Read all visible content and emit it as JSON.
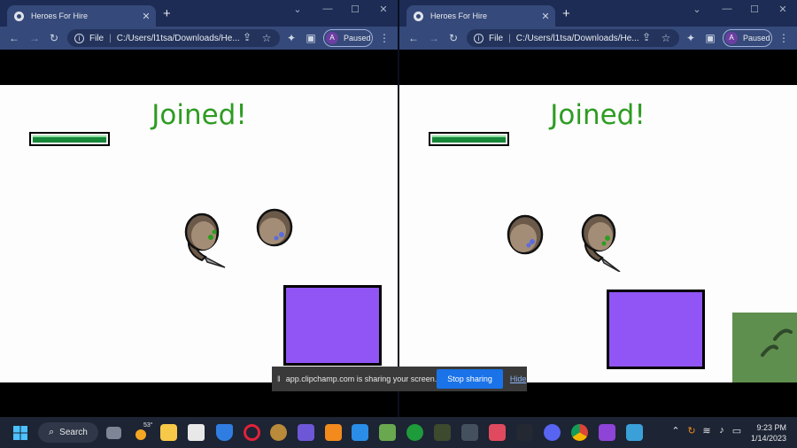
{
  "windows": {
    "left": {
      "tab_title": "Heroes For Hire",
      "address": "C:/Users/l1tsa/Downloads/He...",
      "address_scheme": "File",
      "profile_letter": "A",
      "profile_status": "Paused",
      "game_status": "Joined!"
    },
    "right": {
      "tab_title": "Heroes For Hire",
      "address": "C:/Users/l1tsa/Downloads/He...",
      "address_scheme": "File",
      "profile_letter": "A",
      "profile_status": "Paused",
      "game_status": "Joined!"
    }
  },
  "window_controls": {
    "minimize": "—",
    "maximize": "☐",
    "close": "✕",
    "new_tab": "+",
    "tab_close": "✕",
    "dropdown": "⌄"
  },
  "toolbar_icons": [
    "back-icon",
    "forward-icon",
    "reload-icon",
    "share-icon",
    "star-icon",
    "extensions-icon",
    "sidepanel-icon",
    "menu-icon"
  ],
  "game": {
    "health_fraction": 1.0,
    "colors": {
      "health": "#17873a",
      "square": "#9055f4",
      "status_text": "#2e9c22",
      "terrain": "#5f8f4e"
    }
  },
  "screen_share": {
    "message": "app.clipchamp.com is sharing your screen.",
    "stop_label": "Stop sharing",
    "hide_label": "Hide"
  },
  "taskbar": {
    "search_label": "Search",
    "weather_temp": "53°",
    "time": "9:23 PM",
    "date": "1/14/2023",
    "apps": [
      "windows-start-icon",
      "search-icon",
      "task-view-icon",
      "weather-icon",
      "file-explorer-icon",
      "app-icon",
      "security-icon",
      "opera-icon",
      "game-icon",
      "notes-icon",
      "sublime-icon",
      "vscode-icon",
      "minecraft-icon",
      "xbox-icon",
      "terminal-icon",
      "game-bar-icon",
      "app-store-icon",
      "alienware-icon",
      "discord-icon",
      "chrome-icon",
      "clipchamp-icon",
      "explorer-icon"
    ]
  }
}
